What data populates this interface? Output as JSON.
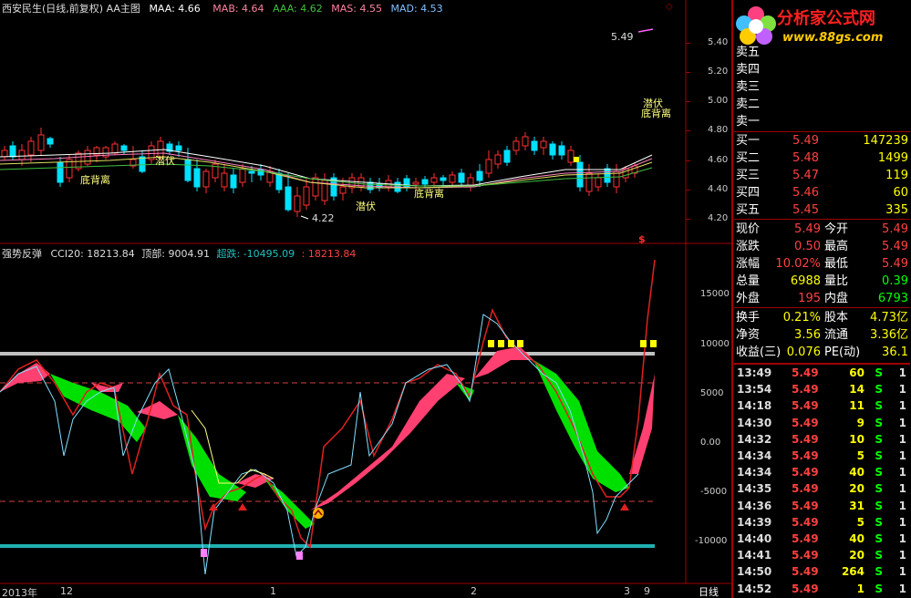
{
  "main_header": {
    "title": "西安民生(日线,前复权) AA主图",
    "maa": "MAA: 4.66",
    "mab": "MAB: 4.64",
    "aaa": "AAA: 4.62",
    "mas": "MAS: 4.55",
    "mad": "MAD: 4.53"
  },
  "watermark": {
    "title": "分析家公式网",
    "url": "www.88gs.com"
  },
  "price_axis": {
    "ticks": [
      "5.40",
      "5.20",
      "5.00",
      "4.80",
      "4.60",
      "4.40",
      "4.20"
    ]
  },
  "main_annotations": {
    "high_label": "5.49",
    "low_label": "4.22",
    "a1": "底背离",
    "a2": "潜伏",
    "a3": "潜伏",
    "a4": "底背离",
    "a5": "潜伏",
    "a6": "底背离"
  },
  "indicator_header": {
    "title": "强势反弹",
    "cci": "CCI20: 18213.84",
    "top": "顶部: 9004.91",
    "oversold": "超跌: -10495.09",
    "extra": ": 18213.84"
  },
  "indicator_axis": {
    "ticks": [
      "15000",
      "10000",
      "5000",
      "0.00",
      "-5000",
      "-10000"
    ]
  },
  "dollar_mark": "$",
  "date_axis": {
    "labels": [
      "2013年",
      "12",
      "1",
      "2",
      "3",
      "9"
    ],
    "period": "日线"
  },
  "order_book": {
    "asks": [
      {
        "label": "卖五",
        "price": "",
        "vol": ""
      },
      {
        "label": "卖四",
        "price": "",
        "vol": ""
      },
      {
        "label": "卖三",
        "price": "",
        "vol": ""
      },
      {
        "label": "卖二",
        "price": "",
        "vol": ""
      },
      {
        "label": "卖一",
        "price": "",
        "vol": ""
      }
    ],
    "bids": [
      {
        "label": "买一",
        "price": "5.49",
        "vol": "147239"
      },
      {
        "label": "买二",
        "price": "5.48",
        "vol": "1499"
      },
      {
        "label": "买三",
        "price": "5.47",
        "vol": "119"
      },
      {
        "label": "买四",
        "price": "5.46",
        "vol": "60"
      },
      {
        "label": "买五",
        "price": "5.45",
        "vol": "335"
      }
    ]
  },
  "stats": {
    "xianjia_l": "现价",
    "xianjia_v": "5.49",
    "jinkai_l": "今开",
    "jinkai_v": "5.49",
    "zhangdie_l": "涨跌",
    "zhangdie_v": "0.50",
    "zuigao_l": "最高",
    "zuigao_v": "5.49",
    "zhangfu_l": "涨幅",
    "zhangfu_v": "10.02%",
    "zuidi_l": "最低",
    "zuidi_v": "5.49",
    "zongliang_l": "总量",
    "zongliang_v": "6988",
    "liangbi_l": "量比",
    "liangbi_v": "0.39",
    "waipan_l": "外盘",
    "waipan_v": "195",
    "neipan_l": "内盘",
    "neipan_v": "6793",
    "huanshou_l": "换手",
    "huanshou_v": "0.21%",
    "guben_l": "股本",
    "guben_v": "4.73亿",
    "jingzi_l": "净资",
    "jingzi_v": "3.56",
    "liutong_l": "流通",
    "liutong_v": "3.36亿",
    "shouyi_l": "收益(三)",
    "shouyi_v": "0.076",
    "pe_l": "PE(动)",
    "pe_v": "36.1"
  },
  "ticks": [
    {
      "time": "13:49",
      "price": "5.49",
      "vol": "60",
      "side": "S",
      "n": "1"
    },
    {
      "time": "13:54",
      "price": "5.49",
      "vol": "14",
      "side": "S",
      "n": "1"
    },
    {
      "time": "14:18",
      "price": "5.49",
      "vol": "11",
      "side": "S",
      "n": "1"
    },
    {
      "time": "14:30",
      "price": "5.49",
      "vol": "9",
      "side": "S",
      "n": "1"
    },
    {
      "time": "14:32",
      "price": "5.49",
      "vol": "10",
      "side": "S",
      "n": "1"
    },
    {
      "time": "14:34",
      "price": "5.49",
      "vol": "5",
      "side": "S",
      "n": "1"
    },
    {
      "time": "14:34",
      "price": "5.49",
      "vol": "40",
      "side": "S",
      "n": "1"
    },
    {
      "time": "14:35",
      "price": "5.49",
      "vol": "20",
      "side": "S",
      "n": "1"
    },
    {
      "time": "14:36",
      "price": "5.49",
      "vol": "31",
      "side": "S",
      "n": "1"
    },
    {
      "time": "14:39",
      "price": "5.49",
      "vol": "5",
      "side": "S",
      "n": "1"
    },
    {
      "time": "14:40",
      "price": "5.49",
      "vol": "40",
      "side": "S",
      "n": "1"
    },
    {
      "time": "14:41",
      "price": "5.49",
      "vol": "20",
      "side": "S",
      "n": "1"
    },
    {
      "time": "14:50",
      "price": "5.49",
      "vol": "264",
      "side": "S",
      "n": "1"
    },
    {
      "time": "14:52",
      "price": "5.49",
      "vol": "1",
      "side": "S",
      "n": "1"
    }
  ],
  "colors": {
    "up": "#ff3030",
    "down": "#00ffff",
    "grid": "#800000",
    "band_up": "#ff4070",
    "band_down": "#00e000",
    "top_line": "#c0c0c0",
    "bottom_line": "#20b0b0"
  }
}
